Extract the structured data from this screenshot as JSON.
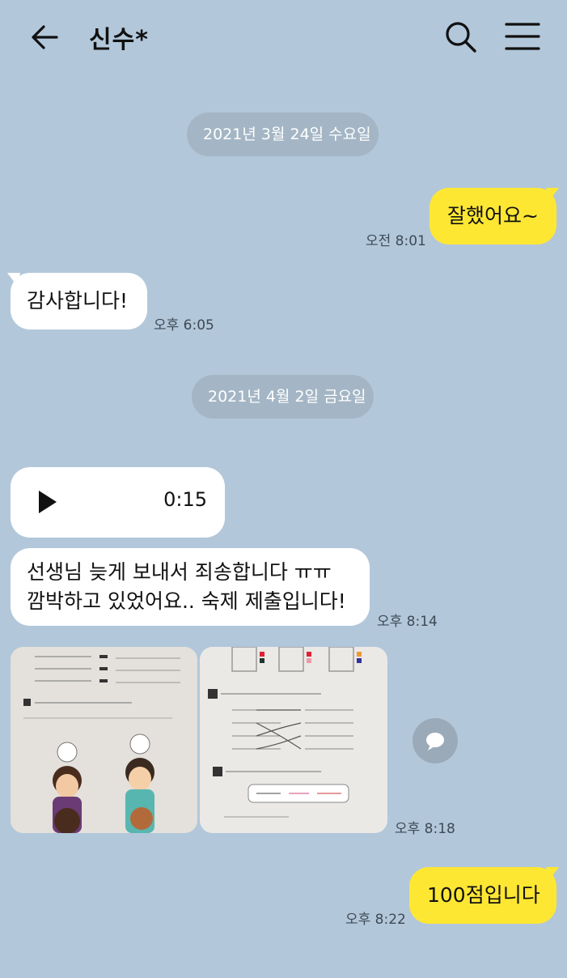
{
  "header": {
    "title": "신수*"
  },
  "messages": {
    "date1": "2021년 3월 24일 수요일",
    "m1": {
      "text": "잘했어요~",
      "time": "오전 8:01"
    },
    "m2": {
      "text": "감사합니다!",
      "time": "오후 6:05"
    },
    "date2": "2021년 4월 2일 금요일",
    "voice": {
      "duration": "0:15"
    },
    "m3": {
      "line1": "선생님 늦게 보내서 죄송합니다 ㅠㅠ",
      "line2": "깜박하고 있었어요.. 숙제 제출입니다!",
      "time": "오후 8:14"
    },
    "photos": {
      "time": "오후 8:18"
    },
    "m4": {
      "text": "100점입니다",
      "time": "오후 8:22"
    }
  },
  "colors": {
    "background": "#b2c7da",
    "my_bubble": "#fee733",
    "their_bubble": "#ffffff",
    "date_pill": "#a4b6c5"
  },
  "icons": {
    "back": "arrow-left-icon",
    "search": "search-icon",
    "menu": "menu-icon",
    "play": "play-icon",
    "share": "share-icon"
  }
}
